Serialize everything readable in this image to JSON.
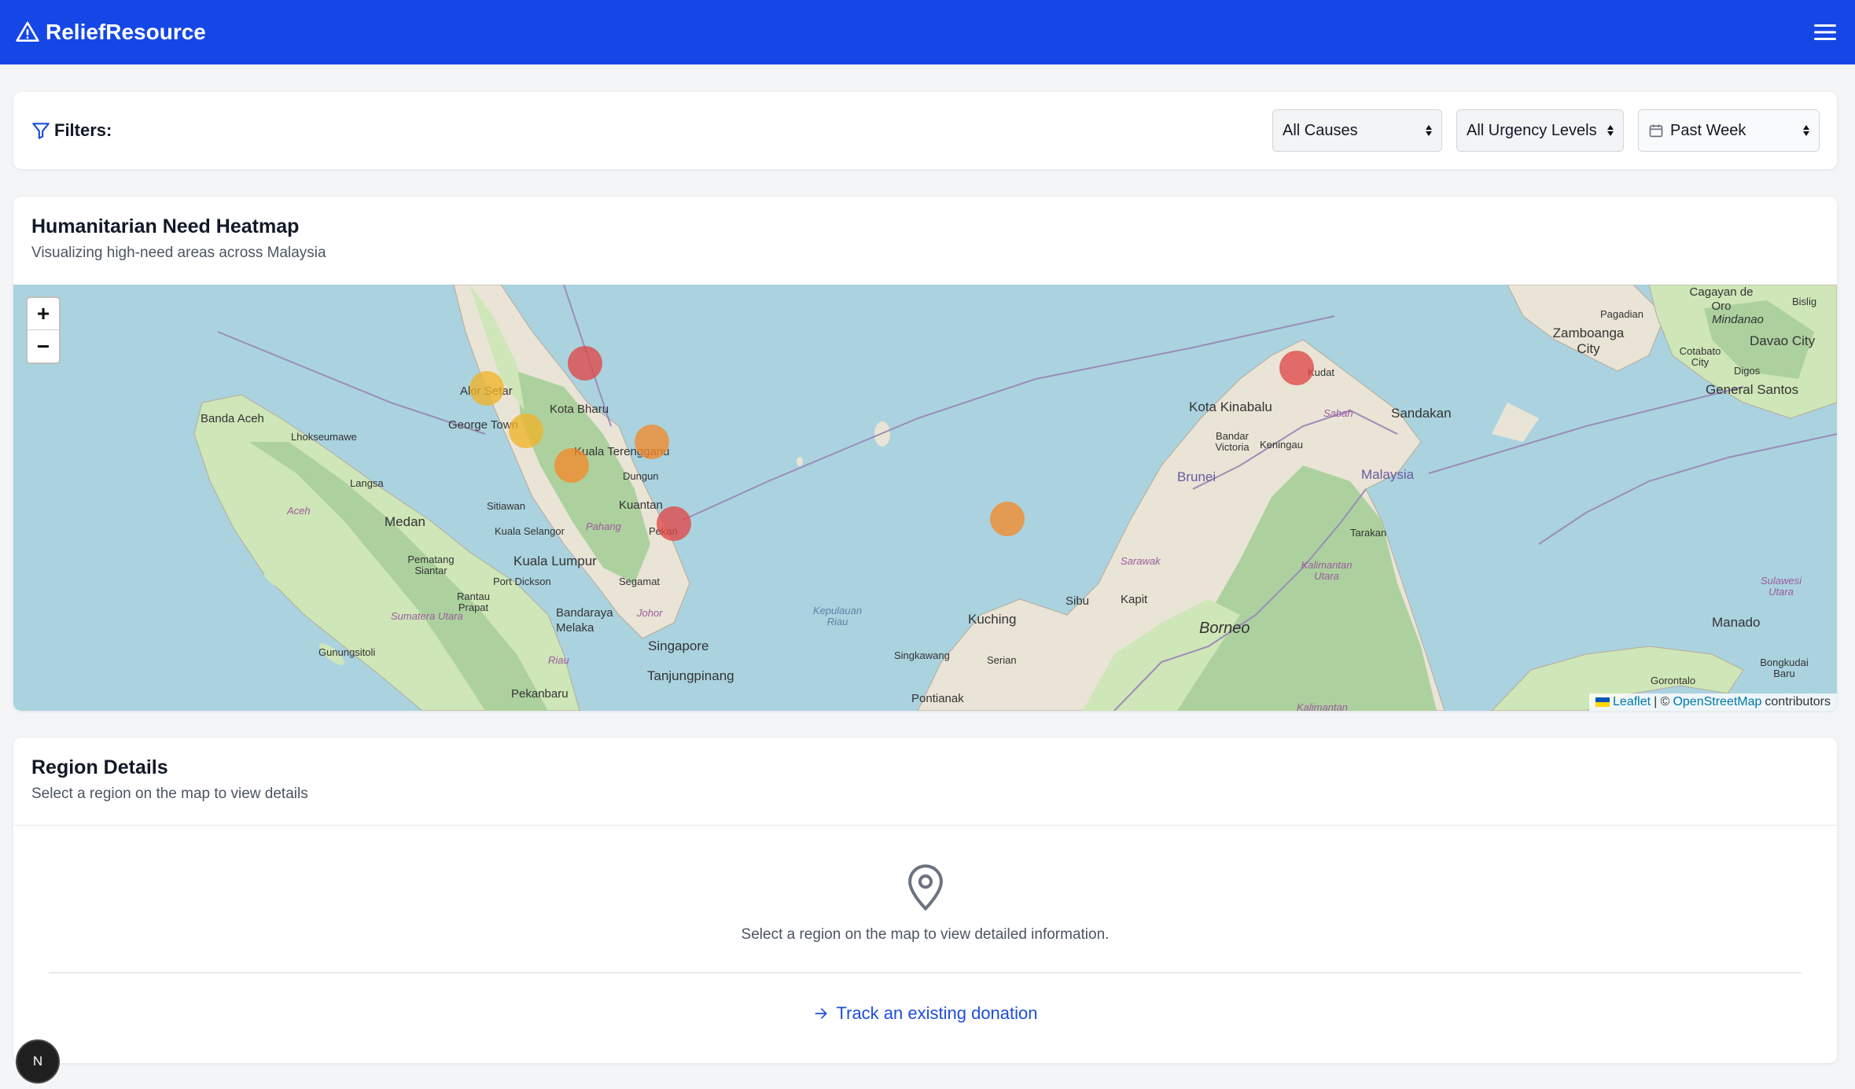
{
  "header": {
    "brand": "ReliefResource",
    "brand_color": "#1546e6"
  },
  "filters": {
    "label": "Filters:",
    "cause": "All Causes",
    "urgency": "All Urgency Levels",
    "period": "Past Week"
  },
  "heatmap": {
    "title": "Humanitarian Need Heatmap",
    "subtitle": "Visualizing high-need areas across Malaysia",
    "zoom_in": "+",
    "zoom_out": "−",
    "attribution": {
      "leaflet": "Leaflet",
      "sep": "| ©",
      "osm": "OpenStreetMap",
      "contributors": "contributors"
    },
    "places": [
      "Banda Aceh",
      "Lhokseumawe",
      "Langsa",
      "Aceh",
      "Medan",
      "Pematang Siantar",
      "Rantau Prapat",
      "Sumatera Utara",
      "Gunungsitoli",
      "Pekanbaru",
      "Riau",
      "Alor Setar",
      "George Town",
      "Kota Bharu",
      "Kuala Terengganu",
      "Dungun",
      "Sitiawan",
      "Kuantan",
      "Pekan",
      "Pahang",
      "Kuala Selangor",
      "Kuala Lumpur",
      "Port Dickson",
      "Segamat",
      "Bandaraya Melaka",
      "Johor",
      "Singapore",
      "Tanjungpinang",
      "Kepulauan Riau",
      "Singkawang",
      "Kuching",
      "Serian",
      "Pontianak",
      "Sibu",
      "Kapit",
      "Sarawak",
      "Borneo",
      "Brunei",
      "Bandar Victoria",
      "Kota Kinabalu",
      "Keningau",
      "Kudat",
      "Sabah",
      "Sandakan",
      "Malaysia",
      "Tarakan",
      "Kalimantan Utara",
      "Kalimantan",
      "Zamboanga City",
      "Pagadian",
      "Cagayan de Oro",
      "Mindanao",
      "Bislig",
      "Davao City",
      "Cotabato City",
      "Digos",
      "General Santos",
      "Manado",
      "Sulawesi Utara",
      "Gorontalo",
      "Bongkudai Baru"
    ],
    "hotspots": [
      {
        "name": "Kota Bharu",
        "level": "high",
        "color": "#e04848"
      },
      {
        "name": "George Town",
        "level": "medium",
        "color": "#f0b429"
      },
      {
        "name": "Sitiawan",
        "level": "medium",
        "color": "#f0b429"
      },
      {
        "name": "Kuantan",
        "level": "elevated",
        "color": "#f38a2b"
      },
      {
        "name": "Kuala Lumpur",
        "level": "elevated",
        "color": "#f38a2b"
      },
      {
        "name": "Singapore",
        "level": "high",
        "color": "#e04848"
      },
      {
        "name": "Kuching",
        "level": "elevated",
        "color": "#f38a2b"
      },
      {
        "name": "Kota Kinabalu",
        "level": "high",
        "color": "#e04848"
      }
    ]
  },
  "region": {
    "title": "Region Details",
    "subtitle": "Select a region on the map to view details",
    "empty_message": "Select a region on the map to view detailed information.",
    "track_link": "Track an existing donation"
  },
  "dev_badge": "N"
}
